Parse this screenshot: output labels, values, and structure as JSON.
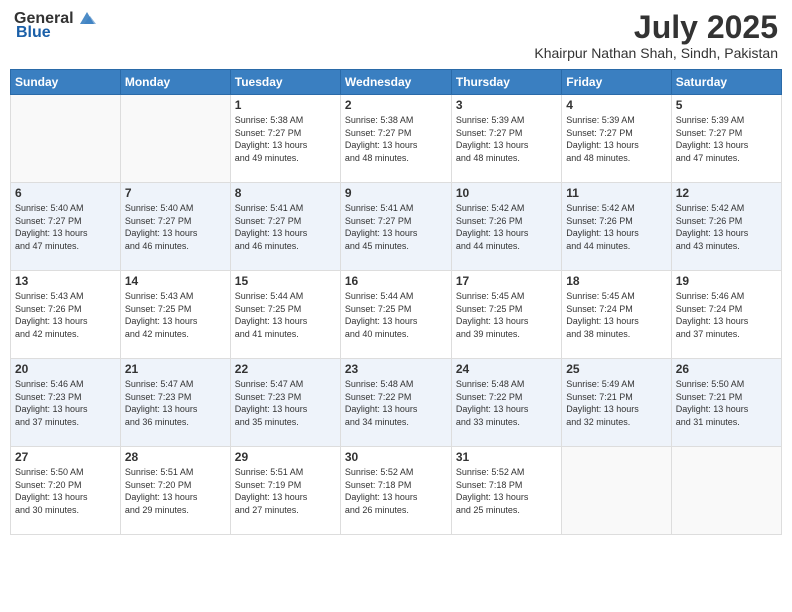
{
  "header": {
    "logo": {
      "general": "General",
      "blue": "Blue"
    },
    "title": "July 2025",
    "location": "Khairpur Nathan Shah, Sindh, Pakistan"
  },
  "calendar": {
    "weekdays": [
      "Sunday",
      "Monday",
      "Tuesday",
      "Wednesday",
      "Thursday",
      "Friday",
      "Saturday"
    ],
    "weeks": [
      [
        {
          "day": "",
          "info": ""
        },
        {
          "day": "",
          "info": ""
        },
        {
          "day": "1",
          "info": "Sunrise: 5:38 AM\nSunset: 7:27 PM\nDaylight: 13 hours\nand 49 minutes."
        },
        {
          "day": "2",
          "info": "Sunrise: 5:38 AM\nSunset: 7:27 PM\nDaylight: 13 hours\nand 48 minutes."
        },
        {
          "day": "3",
          "info": "Sunrise: 5:39 AM\nSunset: 7:27 PM\nDaylight: 13 hours\nand 48 minutes."
        },
        {
          "day": "4",
          "info": "Sunrise: 5:39 AM\nSunset: 7:27 PM\nDaylight: 13 hours\nand 48 minutes."
        },
        {
          "day": "5",
          "info": "Sunrise: 5:39 AM\nSunset: 7:27 PM\nDaylight: 13 hours\nand 47 minutes."
        }
      ],
      [
        {
          "day": "6",
          "info": "Sunrise: 5:40 AM\nSunset: 7:27 PM\nDaylight: 13 hours\nand 47 minutes."
        },
        {
          "day": "7",
          "info": "Sunrise: 5:40 AM\nSunset: 7:27 PM\nDaylight: 13 hours\nand 46 minutes."
        },
        {
          "day": "8",
          "info": "Sunrise: 5:41 AM\nSunset: 7:27 PM\nDaylight: 13 hours\nand 46 minutes."
        },
        {
          "day": "9",
          "info": "Sunrise: 5:41 AM\nSunset: 7:27 PM\nDaylight: 13 hours\nand 45 minutes."
        },
        {
          "day": "10",
          "info": "Sunrise: 5:42 AM\nSunset: 7:26 PM\nDaylight: 13 hours\nand 44 minutes."
        },
        {
          "day": "11",
          "info": "Sunrise: 5:42 AM\nSunset: 7:26 PM\nDaylight: 13 hours\nand 44 minutes."
        },
        {
          "day": "12",
          "info": "Sunrise: 5:42 AM\nSunset: 7:26 PM\nDaylight: 13 hours\nand 43 minutes."
        }
      ],
      [
        {
          "day": "13",
          "info": "Sunrise: 5:43 AM\nSunset: 7:26 PM\nDaylight: 13 hours\nand 42 minutes."
        },
        {
          "day": "14",
          "info": "Sunrise: 5:43 AM\nSunset: 7:25 PM\nDaylight: 13 hours\nand 42 minutes."
        },
        {
          "day": "15",
          "info": "Sunrise: 5:44 AM\nSunset: 7:25 PM\nDaylight: 13 hours\nand 41 minutes."
        },
        {
          "day": "16",
          "info": "Sunrise: 5:44 AM\nSunset: 7:25 PM\nDaylight: 13 hours\nand 40 minutes."
        },
        {
          "day": "17",
          "info": "Sunrise: 5:45 AM\nSunset: 7:25 PM\nDaylight: 13 hours\nand 39 minutes."
        },
        {
          "day": "18",
          "info": "Sunrise: 5:45 AM\nSunset: 7:24 PM\nDaylight: 13 hours\nand 38 minutes."
        },
        {
          "day": "19",
          "info": "Sunrise: 5:46 AM\nSunset: 7:24 PM\nDaylight: 13 hours\nand 37 minutes."
        }
      ],
      [
        {
          "day": "20",
          "info": "Sunrise: 5:46 AM\nSunset: 7:23 PM\nDaylight: 13 hours\nand 37 minutes."
        },
        {
          "day": "21",
          "info": "Sunrise: 5:47 AM\nSunset: 7:23 PM\nDaylight: 13 hours\nand 36 minutes."
        },
        {
          "day": "22",
          "info": "Sunrise: 5:47 AM\nSunset: 7:23 PM\nDaylight: 13 hours\nand 35 minutes."
        },
        {
          "day": "23",
          "info": "Sunrise: 5:48 AM\nSunset: 7:22 PM\nDaylight: 13 hours\nand 34 minutes."
        },
        {
          "day": "24",
          "info": "Sunrise: 5:48 AM\nSunset: 7:22 PM\nDaylight: 13 hours\nand 33 minutes."
        },
        {
          "day": "25",
          "info": "Sunrise: 5:49 AM\nSunset: 7:21 PM\nDaylight: 13 hours\nand 32 minutes."
        },
        {
          "day": "26",
          "info": "Sunrise: 5:50 AM\nSunset: 7:21 PM\nDaylight: 13 hours\nand 31 minutes."
        }
      ],
      [
        {
          "day": "27",
          "info": "Sunrise: 5:50 AM\nSunset: 7:20 PM\nDaylight: 13 hours\nand 30 minutes."
        },
        {
          "day": "28",
          "info": "Sunrise: 5:51 AM\nSunset: 7:20 PM\nDaylight: 13 hours\nand 29 minutes."
        },
        {
          "day": "29",
          "info": "Sunrise: 5:51 AM\nSunset: 7:19 PM\nDaylight: 13 hours\nand 27 minutes."
        },
        {
          "day": "30",
          "info": "Sunrise: 5:52 AM\nSunset: 7:18 PM\nDaylight: 13 hours\nand 26 minutes."
        },
        {
          "day": "31",
          "info": "Sunrise: 5:52 AM\nSunset: 7:18 PM\nDaylight: 13 hours\nand 25 minutes."
        },
        {
          "day": "",
          "info": ""
        },
        {
          "day": "",
          "info": ""
        }
      ]
    ]
  }
}
